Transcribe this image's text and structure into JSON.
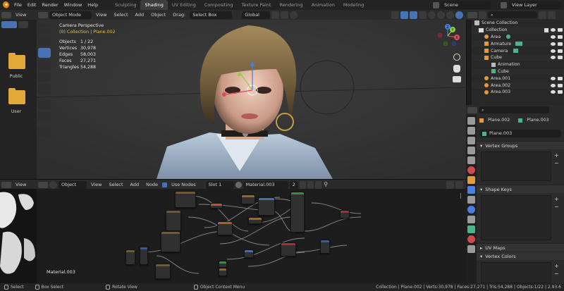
{
  "topbar": {
    "menus": [
      "File",
      "Edit",
      "Render",
      "Window",
      "Help"
    ],
    "workspaces": [
      "Sculpting",
      "Shading",
      "UV Editing",
      "Compositing",
      "Texture Paint",
      "Rendering",
      "Animation",
      "Modeling"
    ],
    "active_workspace": "Shading",
    "scene": "Scene",
    "view_layer": "View Layer"
  },
  "file_header": {
    "view": "View"
  },
  "viewport_header": {
    "mode": "Object Mode",
    "view": "View",
    "select": "Select",
    "add": "Add",
    "object": "Object",
    "drag_label": "Drag:",
    "drag_value": "Select Box",
    "orientation": "Global"
  },
  "file_browser": {
    "items": [
      {
        "label": "Public"
      },
      {
        "label": "User"
      }
    ]
  },
  "viewport_stats": {
    "camera": "Camera Perspective",
    "collection": "(0) Collection | Plane.002",
    "rows": [
      {
        "k": "Objects",
        "v": "1 / 22"
      },
      {
        "k": "Vertices",
        "v": "30,978"
      },
      {
        "k": "Edges",
        "v": "58,003"
      },
      {
        "k": "Faces",
        "v": "27,271"
      },
      {
        "k": "Triangles",
        "v": "54,288"
      }
    ]
  },
  "gizmo": {
    "x": "X",
    "y": "Y",
    "z": "Z"
  },
  "outliner": {
    "title": "Scene Collection",
    "rows": [
      {
        "label": "Collection",
        "indent": 1
      },
      {
        "label": "Area",
        "indent": 2
      },
      {
        "label": "Armature",
        "indent": 2
      },
      {
        "label": "Camera",
        "indent": 2
      },
      {
        "label": "Cube",
        "indent": 2
      },
      {
        "label": "Animation",
        "indent": 3
      },
      {
        "label": "Cube",
        "indent": 3
      },
      {
        "label": "Area.001",
        "indent": 2
      },
      {
        "label": "Area.002",
        "indent": 2
      },
      {
        "label": "Area.003",
        "indent": 2
      }
    ]
  },
  "properties": {
    "object_name": "Plane.002",
    "mesh_name": "Plane.003",
    "data_name": "Plane.003",
    "panels": [
      "Vertex Groups",
      "Shape Keys",
      "UV Maps",
      "Vertex Colors"
    ]
  },
  "node_header": {
    "object": "Object",
    "view": "View",
    "select": "Select",
    "add": "Add",
    "node": "Node",
    "use_nodes": "Use Nodes",
    "slot": "Slot 1",
    "material": "Material.003",
    "users": "2"
  },
  "uv_header": {
    "view": "View"
  },
  "node_editor": {
    "material_label": "Material.003"
  },
  "statusbar": {
    "select": "Select",
    "box_select": "Box Select",
    "rotate_view": "Rotate View",
    "context_menu": "Object Context Menu",
    "info": "Collection | Plane.002 | Verts:30,978 | Faces:27,271 | Tris:54,288 | Objects:1/22 | 2.93.6"
  },
  "colors": {
    "accent": "#4772b3",
    "header": "#2b2b2b",
    "viewport": "#393939",
    "folder": "#e3a83a"
  }
}
